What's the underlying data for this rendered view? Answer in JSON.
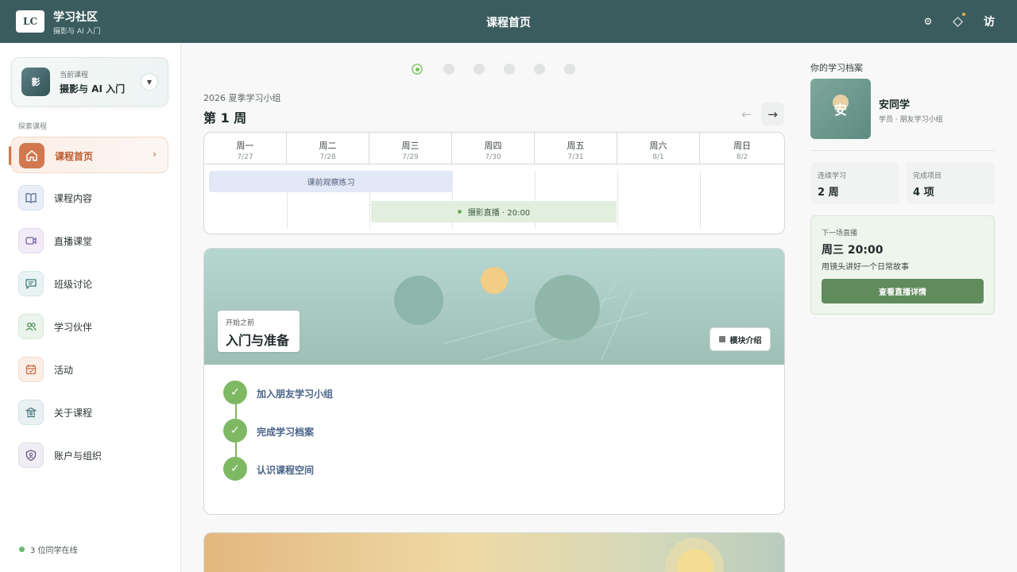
{
  "app": {
    "logo": "LC",
    "title": "学习社区",
    "subtitle": "摄影与 AI 入门",
    "page_title": "课程首页",
    "icons": [
      "gear-icon",
      "diamond-icon"
    ],
    "visitor": "访",
    "accent": "#3a5c5f"
  },
  "sidebar": {
    "course_caption": "当前课程",
    "course_thumb": "影",
    "course_name": "摄影与 AI 入门",
    "explore_label": "探索课程",
    "items": [
      {
        "label": "课程首页",
        "icon": "home-icon",
        "active": true
      },
      {
        "label": "课程内容",
        "icon": "book-icon"
      },
      {
        "label": "直播课堂",
        "icon": "video-icon"
      },
      {
        "label": "班级讨论",
        "icon": "chat-icon"
      },
      {
        "label": "学习伙伴",
        "icon": "users-icon"
      },
      {
        "label": "活动",
        "icon": "calendar-icon"
      },
      {
        "label": "关于课程",
        "icon": "institution-icon"
      },
      {
        "label": "账户与组织",
        "icon": "shield-user-icon"
      }
    ],
    "online_text": "3 位同学在线"
  },
  "main": {
    "group_label": "2026 夏季学习小组",
    "week_title": "第 1 周",
    "pages": 6,
    "current_page": 1,
    "days": [
      {
        "name": "周一",
        "date": "7/27"
      },
      {
        "name": "周二",
        "date": "7/28"
      },
      {
        "name": "周三",
        "date": "7/29"
      },
      {
        "name": "周四",
        "date": "7/30"
      },
      {
        "name": "周五",
        "date": "7/31"
      },
      {
        "name": "周六",
        "date": "8/1"
      },
      {
        "name": "周日",
        "date": "8/2"
      }
    ],
    "events": [
      {
        "label": "课前观察练习"
      },
      {
        "label": "摄影直播 · 20:00"
      }
    ],
    "module": {
      "caption": "开始之前",
      "title": "入门与准备",
      "intro_button": "模块介绍",
      "steps": [
        "加入朋友学习小组",
        "完成学习档案",
        "认识课程空间"
      ]
    }
  },
  "profile": {
    "section_title": "你的学习档案",
    "avatar_char": "安",
    "name": "安同学",
    "role": "学员 · 朋友学习小组",
    "stats": [
      {
        "caption": "连续学习",
        "value": "2 周"
      },
      {
        "caption": "完成项目",
        "value": "4 项"
      }
    ],
    "next_live": {
      "caption": "下一场直播",
      "time": "周三 20:00",
      "desc": "用镜头讲好一个日常故事",
      "button": "查看直播详情"
    }
  }
}
